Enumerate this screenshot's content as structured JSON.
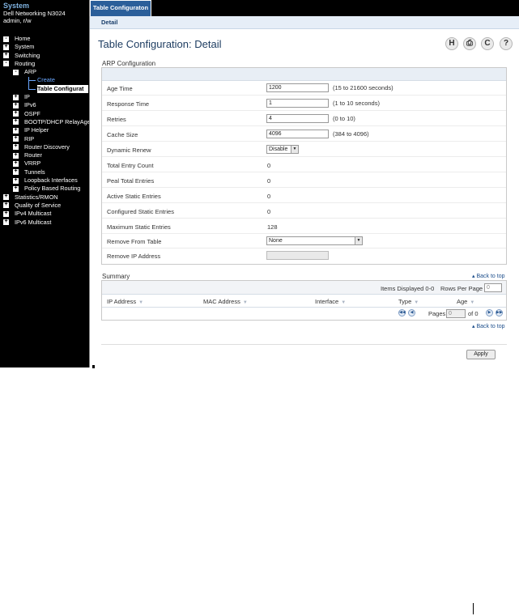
{
  "sidebar": {
    "title": "System",
    "device": "Dell Networking N3024",
    "user": "admin, r/w",
    "tree": [
      {
        "key": "home",
        "label": "Home",
        "level": 0,
        "box": "-"
      },
      {
        "key": "system",
        "label": "System",
        "level": 0,
        "box": "+"
      },
      {
        "key": "switching",
        "label": "Switching",
        "level": 0,
        "box": "+"
      },
      {
        "key": "routing",
        "label": "Routing",
        "level": 0,
        "box": "-"
      },
      {
        "key": "arp",
        "label": "ARP",
        "level": 1,
        "box": "-"
      },
      {
        "key": "create",
        "label": "Create",
        "level": 2,
        "box": ""
      },
      {
        "key": "table-configuration",
        "label": "Table Configurat",
        "level": 2,
        "box": ""
      },
      {
        "key": "ip",
        "label": "IP",
        "level": 1,
        "box": "+"
      },
      {
        "key": "ipv6",
        "label": "IPv6",
        "level": 1,
        "box": "+"
      },
      {
        "key": "ospf",
        "label": "OSPF",
        "level": 1,
        "box": "+"
      },
      {
        "key": "bootp",
        "label": "BOOTP/DHCP RelayAge",
        "level": 1,
        "box": "+"
      },
      {
        "key": "ip-helper",
        "label": "IP Helper",
        "level": 1,
        "box": "+"
      },
      {
        "key": "rip",
        "label": "RIP",
        "level": 1,
        "box": "+"
      },
      {
        "key": "router-discovery",
        "label": "Router Discovery",
        "level": 1,
        "box": "+"
      },
      {
        "key": "router",
        "label": "Router",
        "level": 1,
        "box": "+"
      },
      {
        "key": "vrrp",
        "label": "VRRP",
        "level": 1,
        "box": "+"
      },
      {
        "key": "tunnels",
        "label": "Tunnels",
        "level": 1,
        "box": "+"
      },
      {
        "key": "loopback",
        "label": "Loopback Interfaces",
        "level": 1,
        "box": "+"
      },
      {
        "key": "pbr",
        "label": "Policy Based Routing",
        "level": 1,
        "box": "+"
      },
      {
        "key": "statistics",
        "label": "Statistics/RMON",
        "level": 0,
        "box": "+"
      },
      {
        "key": "qos",
        "label": "Quality of Service",
        "level": 0,
        "box": "+"
      },
      {
        "key": "ipv4-multicast",
        "label": "IPv4 Multicast",
        "level": 0,
        "box": "+"
      },
      {
        "key": "ipv6-multicast",
        "label": "IPv6 Multicast",
        "level": 0,
        "box": "+"
      }
    ]
  },
  "tabs": {
    "main": "Table Configuraton",
    "sub": "Detail"
  },
  "page": {
    "title": "Table Configuration: Detail",
    "icons": {
      "save": "H",
      "print": "⎙",
      "refresh": "C",
      "help": "?"
    }
  },
  "arp": {
    "section": "ARP Configuration",
    "age_time": {
      "label": "Age Time",
      "value": "1200",
      "range": "(15 to 21600 seconds)"
    },
    "response_time": {
      "label": "Response Time",
      "value": "1",
      "range": "(1 to 10 seconds)"
    },
    "retries": {
      "label": "Retries",
      "value": "4",
      "range": "(0 to 10)"
    },
    "cache_size": {
      "label": "Cache Size",
      "value": "4096",
      "range": "(384 to 4096)"
    },
    "dynamic_renew": {
      "label": "Dynamic Renew",
      "value": "Disable"
    },
    "total_entry_count": {
      "label": "Total Entry Count",
      "value": "0"
    },
    "peak_total_entries": {
      "label": "Peal Total Entries",
      "value": "0"
    },
    "active_static_entries": {
      "label": "Active Static Entries",
      "value": "0"
    },
    "configured_static_entries": {
      "label": "Configured Static Entries",
      "value": "0"
    },
    "maximum_static_entries": {
      "label": "Maximum Static Entries",
      "value": "128"
    },
    "remove_from_table": {
      "label": "Remove From Table",
      "value": "None"
    },
    "remove_ip_address": {
      "label": "Remove IP Address",
      "value": ""
    }
  },
  "summary": {
    "section": "Summary",
    "back_to_top": "Back to top",
    "items_displayed": "Items Displayed 0-0",
    "rows_per_page_label": "Rows Per Page",
    "rows_per_page_value": "0",
    "columns": [
      "IP Address",
      "MAC Address",
      "Interface",
      "Type",
      "Age"
    ],
    "pages_label": "Pages",
    "page_value": "0",
    "of_label": "of 0"
  },
  "apply_label": "Apply"
}
